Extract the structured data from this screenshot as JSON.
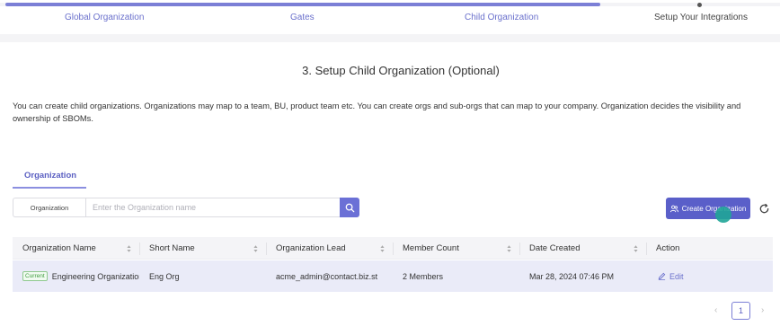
{
  "stepper": {
    "steps": [
      "Global Organization",
      "Gates",
      "Child Organization",
      "Setup Your Integrations"
    ],
    "completed_fraction": 0.76
  },
  "page": {
    "title": "3. Setup Child Organization (Optional)",
    "description": "You can create child organizations. Organizations may map to a team, BU, product team etc. You can create orgs and sub-orgs that can map to your company. Organization decides the visibility and ownership of SBOMs."
  },
  "tabs": [
    "Organization"
  ],
  "search": {
    "label": "Organization",
    "placeholder": "Enter the Organization name",
    "value": ""
  },
  "actions": {
    "create_label": "Create Organization"
  },
  "table": {
    "columns": [
      "Organization Name",
      "Short Name",
      "Organization Lead",
      "Member Count",
      "Date Created",
      "Action"
    ],
    "rows": [
      {
        "badge": "Current",
        "name": "Engineering Organization",
        "short_name": "Eng Org",
        "lead": "acme_admin@contact.biz.st",
        "members": "2 Members",
        "created": "Mar 28, 2024 07:46 PM",
        "action": "Edit"
      }
    ]
  },
  "pagination": {
    "current_page": "1",
    "prev_icon": "chevron-left-icon",
    "next_icon": "chevron-right-icon"
  },
  "colors": {
    "accent": "#5a5fc9",
    "row_highlight": "#eaebf8"
  }
}
